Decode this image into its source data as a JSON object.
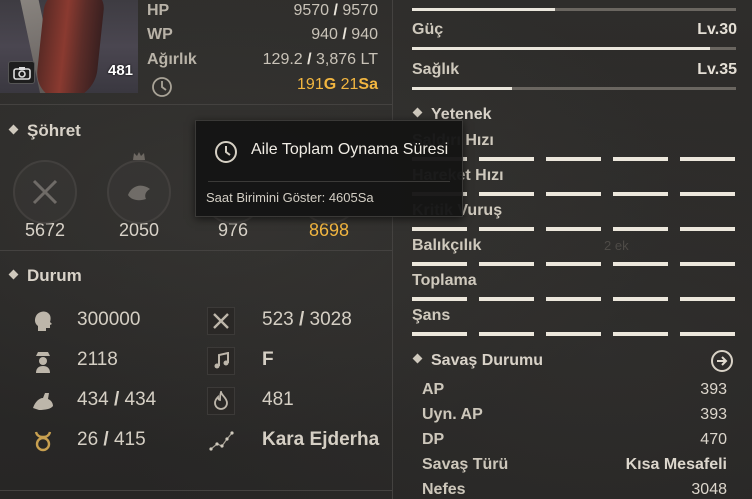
{
  "character": {
    "portrait_level": "481"
  },
  "stats": [
    {
      "label": "HP",
      "value_a": "9570",
      "sep": " / ",
      "value_b": "9570"
    },
    {
      "label": "WP",
      "value_a": "940",
      "sep": " / ",
      "value_b": "940"
    },
    {
      "label": "Ağırlık",
      "value_a": "129.2",
      "sep": " / ",
      "value_b": "3,876 LT"
    }
  ],
  "playtime": {
    "days": "191",
    "days_unit": "G",
    "hours": "21",
    "hours_unit": "Sa"
  },
  "fame": {
    "title": "Şöhret",
    "items": [
      {
        "icon": "crossed-swords-icon",
        "value": "5672"
      },
      {
        "icon": "fish-head-icon",
        "value": "2050"
      },
      {
        "icon": "life-skill-icon",
        "value": "976"
      },
      {
        "icon": "star-emblem-icon",
        "value": "8698"
      }
    ]
  },
  "condition": {
    "title": "Durum",
    "items": [
      {
        "icon": "head-profile-icon",
        "value": "300000"
      },
      {
        "icon": "crossed-tools-icon",
        "value_a": "523",
        "sep": " / ",
        "value_b": "3028"
      },
      {
        "icon": "soldier-icon",
        "value": "2118"
      },
      {
        "icon": "music-note-icon",
        "value": "F"
      },
      {
        "icon": "flexed-arm-icon",
        "value_a": "434",
        "sep": " / ",
        "value_b": "434"
      },
      {
        "icon": "flame-icon",
        "value": "481"
      },
      {
        "icon": "taurus-icon",
        "value_a": "26",
        "sep": " / ",
        "value_b": "415"
      },
      {
        "icon": "constellation-icon",
        "value": "Kara Ejderha"
      }
    ]
  },
  "right_stats": [
    {
      "label": "Güç",
      "level": "Lv.30",
      "fill": 0.92
    },
    {
      "label": "Sağlık",
      "level": "Lv.35",
      "fill": 0.31
    }
  ],
  "skills": {
    "title": "Yetenek",
    "items": [
      {
        "label": "Saldırı Hızı",
        "filled": 0
      },
      {
        "label": "Hareket Hızı",
        "filled": 0
      },
      {
        "label": "Kritik Vuruş",
        "filled": 0
      },
      {
        "label": "Balıkçılık",
        "filled": 0,
        "note": "2 ek"
      },
      {
        "label": "Toplama",
        "filled": 1
      },
      {
        "label": "Şans",
        "filled": 0
      }
    ]
  },
  "battle": {
    "title": "Savaş Durumu",
    "rows": [
      {
        "label": "AP",
        "value": "393"
      },
      {
        "label": "Uyn. AP",
        "value": "393"
      },
      {
        "label": "DP",
        "value": "470"
      },
      {
        "label": "Savaş Türü",
        "value": "Kısa Mesafeli"
      },
      {
        "label": "Nefes",
        "value": "3048"
      }
    ]
  },
  "tooltip": {
    "title": "Aile Toplam Oynama Süresi",
    "body": "Saat Birimini Göster: 4605Sa"
  },
  "colors": {
    "gold": "#f2b640",
    "bar_fill": "#eae6dc",
    "bar_track": "#5a5650"
  }
}
